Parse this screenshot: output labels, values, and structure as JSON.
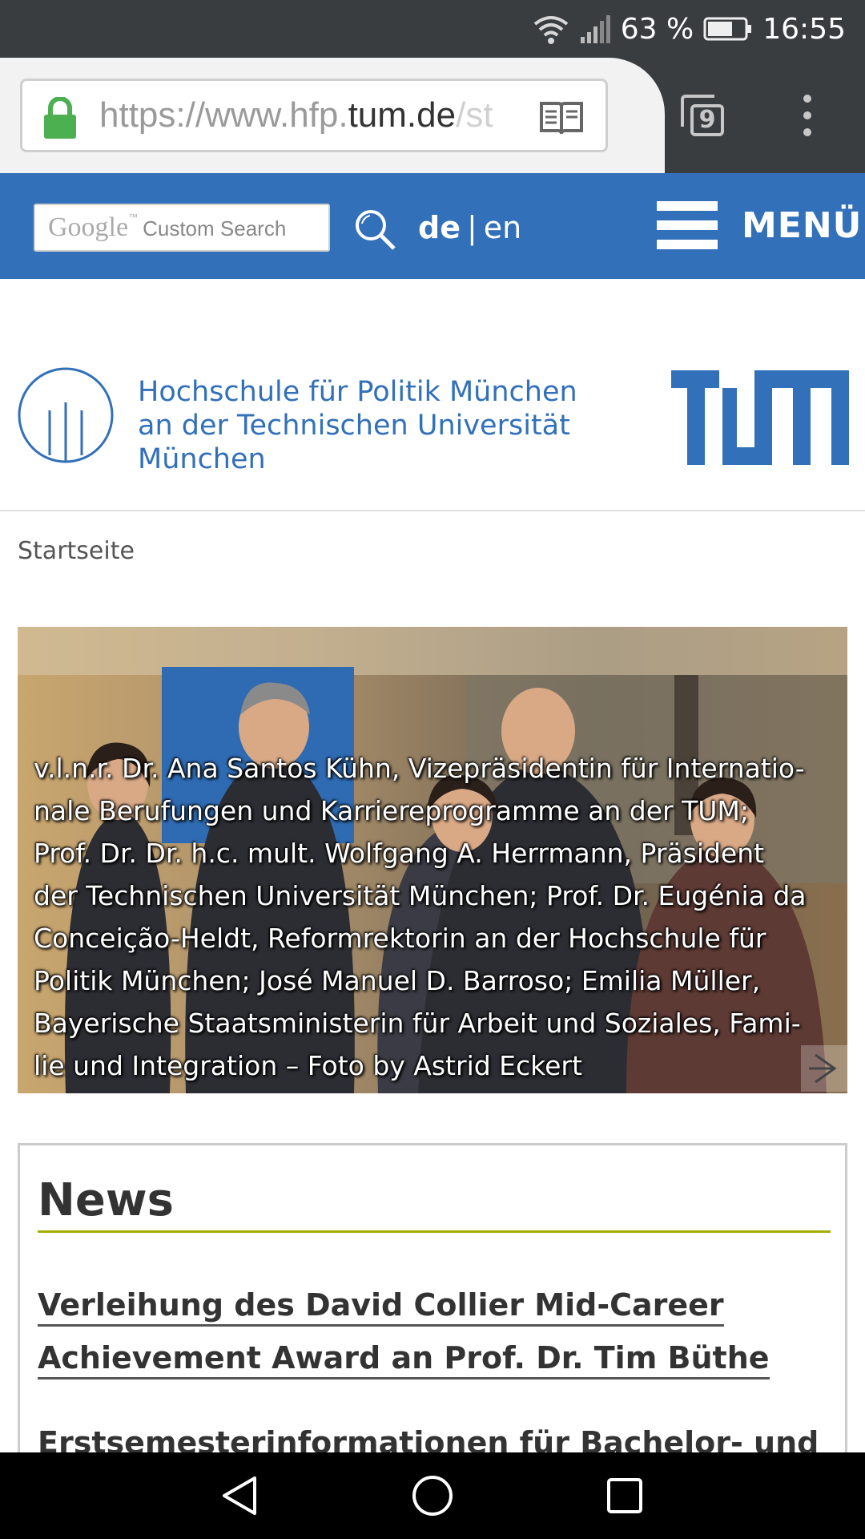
{
  "status_bar": {
    "battery": "63 %",
    "time": "16:55"
  },
  "browser": {
    "url_prefix": "https://www.hfp.",
    "url_domain": "tum.de",
    "url_suffix": "/st",
    "tab_count": "9"
  },
  "site_header": {
    "search_brand": "Google",
    "search_label": "Custom Search",
    "lang_de": "de",
    "lang_separator": "|",
    "lang_en": "en",
    "menu_label": "MENÜ"
  },
  "institution": {
    "line1": "Hochschule für Politik München",
    "line2": "an der Technischen Universität",
    "line3": "München"
  },
  "breadcrumb": "Startseite",
  "hero": {
    "caption_lines": [
      "v.l.n.r. Dr. Ana Santos Kühn, Vizepräsidentin für Internatio-",
      "nale Berufungen und Karriereprogramme an der TUM;",
      "Prof. Dr. Dr. h.c. mult. Wolfgang A. Herrmann, Präsident",
      "der Technischen Universität München; Prof. Dr. Eugénia da",
      "Conceição-Heldt, Reformrektorin an der Hochschule für",
      "Politik München; José Manuel D. Barroso; Emilia Müller,",
      "Bayerische Staatsministerin für Arbeit und Soziales, Fami-",
      "lie und Integration – Foto by Astrid Eckert"
    ]
  },
  "news": {
    "title": "News",
    "items": [
      {
        "line1": "Verleihung des David Collier Mid-Career",
        "line2": "Achievement Award an Prof. Dr. Tim Büthe"
      },
      {
        "line1": "Erstsemesterinformationen für Bachelor- und",
        "line2": ""
      }
    ]
  },
  "colors": {
    "brand_blue": "#3270b9",
    "accent_green": "#a2ad00",
    "lock_green": "#4caf50"
  },
  "icons": [
    "wifi-icon",
    "signal-icon",
    "battery-icon",
    "lock-icon",
    "reader-mode-icon",
    "tabs-icon",
    "more-icon",
    "search-icon",
    "menu-icon",
    "hfp-logo",
    "tum-logo",
    "chevron-right-icon",
    "back-icon",
    "home-icon",
    "recents-icon"
  ]
}
